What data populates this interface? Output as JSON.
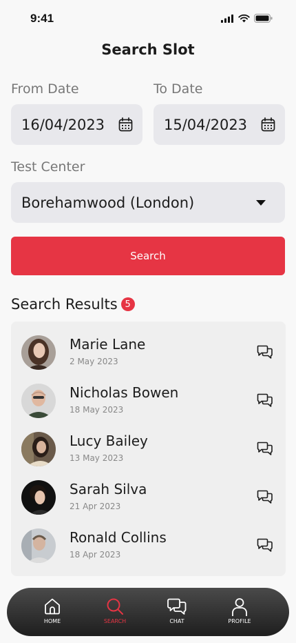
{
  "status_bar": {
    "time": "9:41"
  },
  "title": "Search Slot",
  "form": {
    "from_label": "From Date",
    "from_value": "16/04/2023",
    "to_label": "To Date",
    "to_value": "15/04/2023",
    "center_label": "Test Center",
    "center_value": "Borehamwood (London)"
  },
  "search_button": "Search",
  "results": {
    "title": "Search Results",
    "count": "5",
    "items": [
      {
        "name": "Marie Lane",
        "date": "2 May 2023"
      },
      {
        "name": "Nicholas Bowen",
        "date": "18 May 2023"
      },
      {
        "name": "Lucy Bailey",
        "date": "13 May 2023"
      },
      {
        "name": "Sarah Silva",
        "date": "21 Apr 2023"
      },
      {
        "name": "Ronald Collins",
        "date": "18 Apr 2023"
      }
    ]
  },
  "nav": {
    "items": [
      {
        "label": "HOME",
        "icon": "home-icon"
      },
      {
        "label": "SEARCH",
        "icon": "search-icon",
        "active": true
      },
      {
        "label": "CHAT",
        "icon": "chat-icon"
      },
      {
        "label": "PROFILE",
        "icon": "profile-icon"
      }
    ]
  },
  "colors": {
    "accent": "#e63544",
    "field_bg": "#e8e8ec",
    "nav_bg": "#2a2a2a"
  }
}
